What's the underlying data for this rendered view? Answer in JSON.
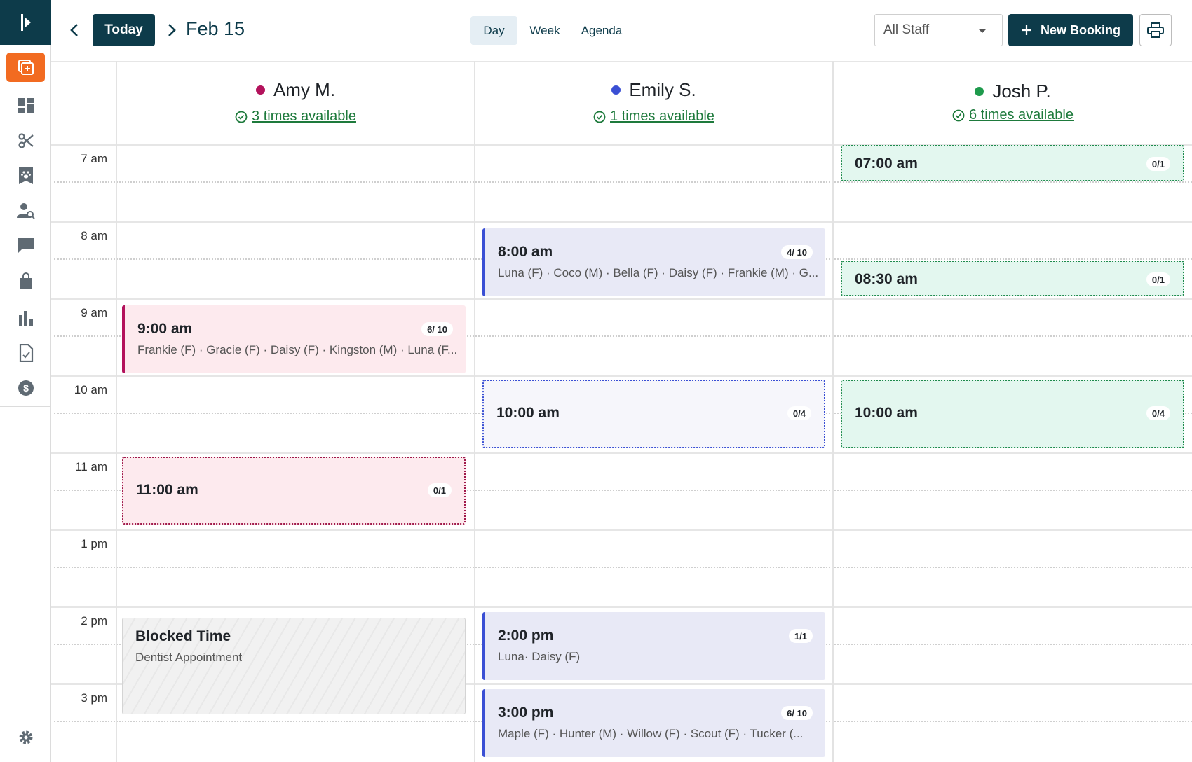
{
  "header": {
    "today_label": "Today",
    "date": "Feb 15",
    "views": [
      "Day",
      "Week",
      "Agenda"
    ],
    "active_view": "Day",
    "staff_filter": "All Staff",
    "new_booking_label": "New Booking"
  },
  "sidebar": {
    "items": [
      "new-booking-icon",
      "dashboard-icon",
      "scissors-icon",
      "pet-book-icon",
      "customer-search-icon",
      "messages-icon",
      "shop-bag-icon",
      "reports-icon",
      "document-icon",
      "billing-icon",
      "settings-icon"
    ]
  },
  "hours": [
    "7 am",
    "8 am",
    "9 am",
    "10 am",
    "11 am",
    "1 pm",
    "2 pm",
    "3 pm"
  ],
  "staff": [
    {
      "name": "Amy M.",
      "color": "#b3125c",
      "availability": "3 times available"
    },
    {
      "name": "Emily S.",
      "color": "#3a4fd4",
      "availability": "1 times available"
    },
    {
      "name": "Josh P.",
      "color": "#1e9a4c",
      "availability": "6 times available"
    }
  ],
  "events": {
    "amy_900": {
      "time": "9:00 am",
      "count": "6/ 10",
      "pets": "Frankie (F) · Gracie (F) · Daisy (F) · Kingston (M) · Luna (F..."
    },
    "amy_1100": {
      "time": "11:00 am",
      "count": "0/1"
    },
    "amy_blocked": {
      "title": "Blocked Time",
      "note": "Dentist Appointment"
    },
    "emily_800": {
      "time": "8:00 am",
      "count": "4/ 10",
      "pets": "Luna (F) · Coco (M) · Bella (F) · Daisy (F) · Frankie (M) · G..."
    },
    "emily_1000": {
      "time": "10:00 am",
      "count": "0/4"
    },
    "emily_200": {
      "time": "2:00 pm",
      "count": "1/1",
      "pets": "Luna· Daisy (F)"
    },
    "emily_300": {
      "time": "3:00 pm",
      "count": "6/ 10",
      "pets": "Maple (F) · Hunter (M) · Willow (F) · Scout (F) ·  Tucker (..."
    },
    "josh_700": {
      "time": "07:00 am",
      "count": "0/1"
    },
    "josh_830": {
      "time": "08:30 am",
      "count": "0/1"
    },
    "josh_1000": {
      "time": "10:00 am",
      "count": "0/4"
    }
  },
  "colors": {
    "brand": "#0d3b4a",
    "accent": "#f26b21"
  }
}
